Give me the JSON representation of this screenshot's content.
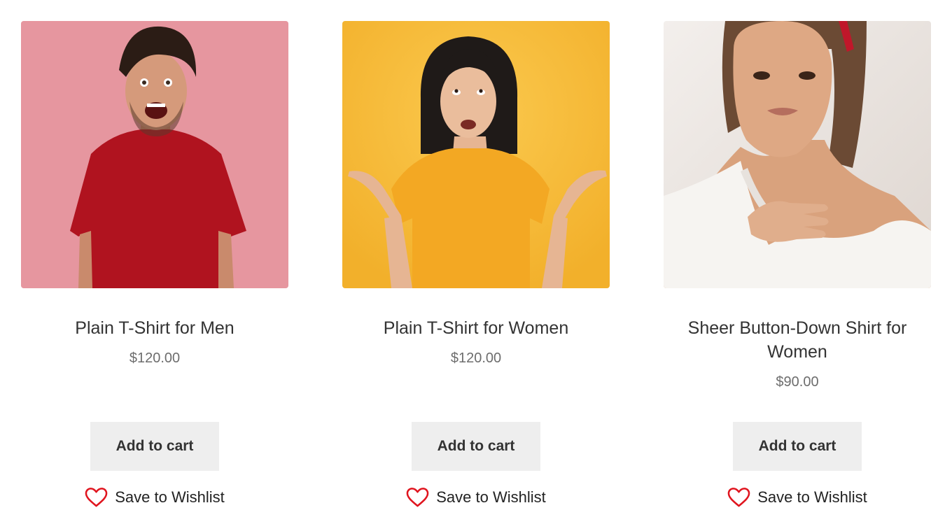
{
  "products": [
    {
      "title": "Plain T-Shirt for Men",
      "price": "$120.00",
      "add_to_cart_label": "Add to cart",
      "wishlist_label": "Save to Wishlist",
      "image_background": "#e89aa3",
      "garment_color": "#b0131f"
    },
    {
      "title": "Plain T-Shirt for Women",
      "price": "$120.00",
      "add_to_cart_label": "Add to cart",
      "wishlist_label": "Save to Wishlist",
      "image_background": "#f7be3c",
      "garment_color": "#f3a823"
    },
    {
      "title": "Sheer Button-Down Shirt for Women",
      "price": "$90.00",
      "add_to_cart_label": "Add to cart",
      "wishlist_label": "Save to Wishlist",
      "image_background": "#ece7e3",
      "garment_color": "#f6f4f1"
    }
  ],
  "icons": {
    "wishlist": "heart-icon"
  },
  "colors": {
    "wishlist_heart": "#e0141e",
    "button_background": "#eeeeee",
    "title_text": "#333333",
    "price_text": "#6d6d6d"
  }
}
